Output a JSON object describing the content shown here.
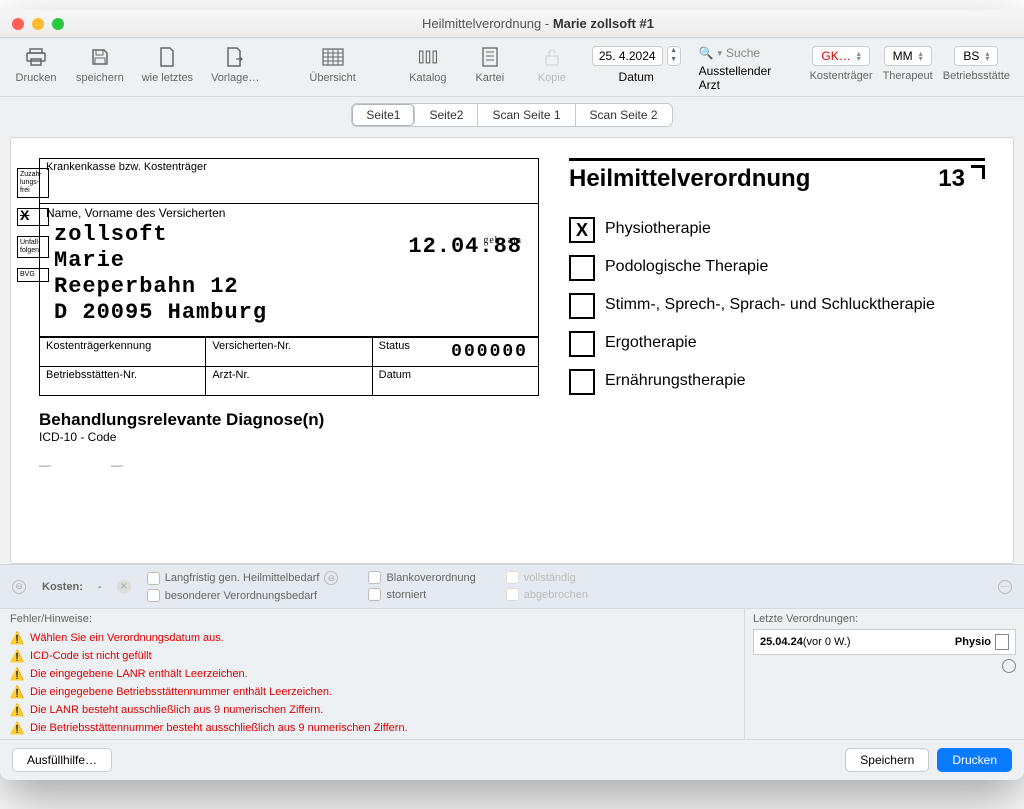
{
  "title": {
    "prefix": "Heilmittelverordnung - ",
    "name": "Marie zollsoft #1"
  },
  "toolbar": {
    "print": "Drucken",
    "save": "speichern",
    "like_last": "wie letztes",
    "template": "Vorlage…",
    "overview": "Übersicht",
    "catalog": "Katalog",
    "card": "Kartei",
    "copy": "Kopie",
    "date_label": "Datum",
    "date_value": "25. 4.2024",
    "search_label": "Ausstellender Arzt",
    "search_placeholder": "Suche",
    "payer": "GK…",
    "payer_label": "Kostenträger",
    "therapist": "MM",
    "therapist_label": "Therapeut",
    "site": "BS",
    "site_label": "Betriebsstätte"
  },
  "tabs": [
    "Seite1",
    "Seite2",
    "Scan Seite 1",
    "Scan Seite 2"
  ],
  "side_tags": [
    "Zuzah-\nlungs-\nfrei",
    "X",
    "Unfall-\nfolgen",
    "BVG"
  ],
  "form": {
    "payer_hdr": "Krankenkasse bzw. Kostenträger",
    "patient_hdr": "Name, Vorname des Versicherten",
    "lastname": "zollsoft",
    "firstname": "Marie",
    "street": "Reeperbahn 12",
    "city": "D 20095 Hamburg",
    "dob_label": "geb. am",
    "dob": "12.04.88",
    "col1": "Kostenträgerkennung",
    "col2": "Versicherten-Nr.",
    "col3": "Status",
    "status_val": "000000",
    "col4": "Betriebsstätten-Nr.",
    "col5": "Arzt-Nr.",
    "col6": "Datum",
    "diag_title": "Behandlungsrelevante Diagnose(n)",
    "diag_sub": "ICD-10 - Code"
  },
  "right": {
    "title": "Heilmittelverordnung",
    "number": "13",
    "therapies": [
      {
        "checked": true,
        "label": "Physiotherapie"
      },
      {
        "checked": false,
        "label": "Podologische Therapie"
      },
      {
        "checked": false,
        "label": "Stimm-, Sprech-, Sprach- und Schlucktherapie"
      },
      {
        "checked": false,
        "label": "Ergotherapie"
      },
      {
        "checked": false,
        "label": "Ernährungstherapie"
      }
    ]
  },
  "status": {
    "kosten_label": "Kosten:",
    "kosten_val": "-",
    "c1": "Langfristig gen. Heilmittelbedarf",
    "c2": "besonderer Verordnungsbedarf",
    "c3": "Blankoverordnung",
    "c4": "storniert",
    "c5": "vollständig",
    "c6": "abgebrochen"
  },
  "errors": {
    "header": "Fehler/Hinweise:",
    "items": [
      "Wählen Sie ein Verordnungsdatum aus.",
      "ICD-Code ist nicht gefüllt",
      "Die eingegebene LANR enthält Leerzeichen.",
      "Die eingegebene Betriebsstättennummer enthält Leerzeichen.",
      "Die LANR besteht ausschließlich aus 9 numerischen Ziffern.",
      "Die Betriebsstättennummer besteht ausschließlich aus 9 numerischen Ziffern."
    ]
  },
  "recent": {
    "header": "Letzte Verordnungen:",
    "date": "25.04.24",
    "ago": "(vor 0 W.)",
    "type": "Physio"
  },
  "footer": {
    "help": "Ausfüllhilfe…",
    "save": "Speichern",
    "print": "Drucken"
  }
}
